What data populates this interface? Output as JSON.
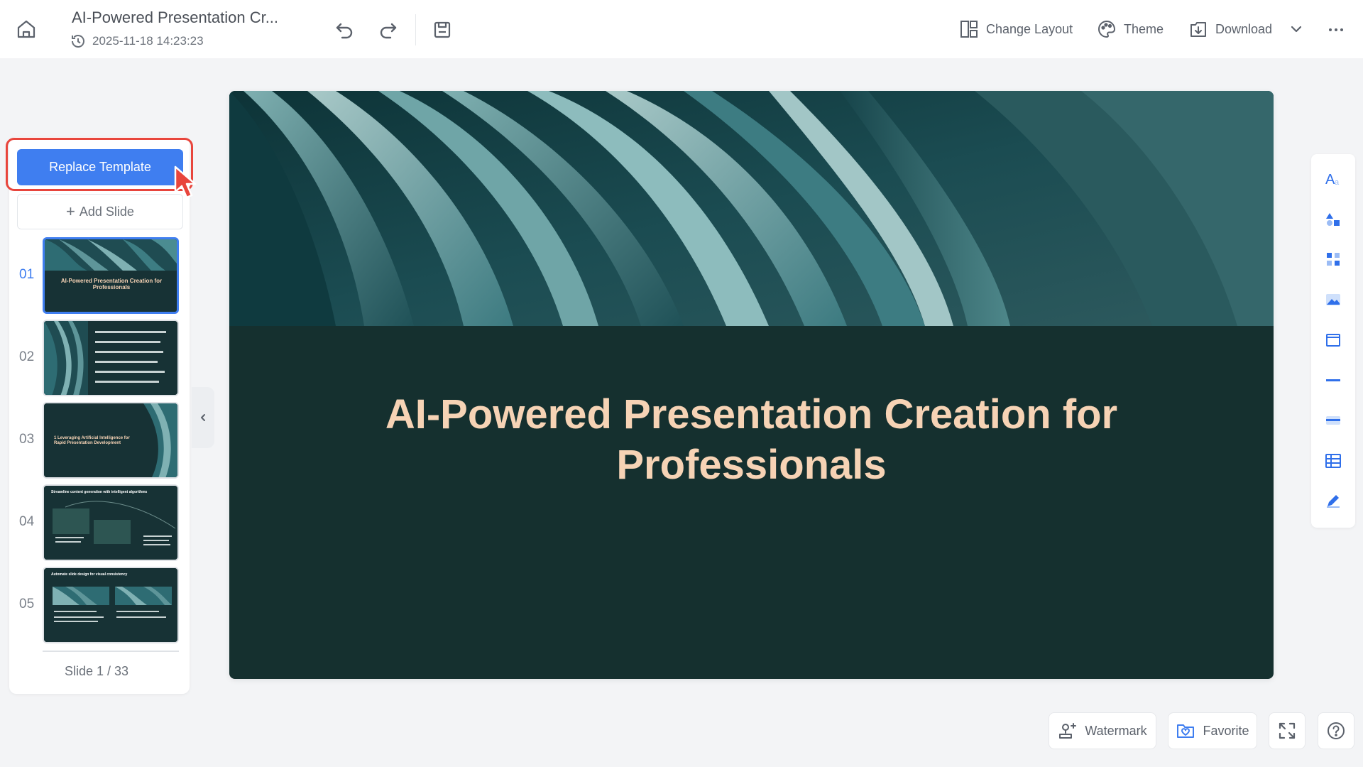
{
  "header": {
    "doc_title": "AI-Powered Presentation Cr...",
    "timestamp": "2025-11-18 14:23:23",
    "icons": [
      "home-icon",
      "history-icon",
      "undo-icon",
      "redo-icon",
      "save-icon"
    ],
    "actions": {
      "change_layout": "Change Layout",
      "theme": "Theme",
      "download": "Download"
    }
  },
  "sidebar": {
    "replace_template": "Replace Template",
    "add_slide": "Add Slide",
    "add_slide_glyph": "+",
    "slides": [
      {
        "num": "01",
        "text": "AI-Powered Presentation Creation for Professionals",
        "active": true
      },
      {
        "num": "02",
        "text": "",
        "active": false
      },
      {
        "num": "03",
        "text": "1 Leveraging Artificial Intelligence for Rapid Presentation Development",
        "active": false
      },
      {
        "num": "04",
        "text": "Streamline content generation with intelligent algorithms",
        "active": false
      },
      {
        "num": "05",
        "text": "Automate slide design for visual consistency",
        "active": false
      }
    ],
    "counter": "Slide 1 / 33"
  },
  "slide": {
    "title": "AI-Powered Presentation Creation for Professionals",
    "colors": {
      "background": "#15302f",
      "title": "#f6d3b5"
    }
  },
  "right_toolbar": {
    "icons": [
      "text-style-icon",
      "shapes-icon",
      "elements-icon",
      "image-icon",
      "frame-icon",
      "line-icon",
      "table-row-icon",
      "table-icon",
      "draw-icon"
    ]
  },
  "bottom": {
    "watermark": "Watermark",
    "favorite": "Favorite"
  },
  "colors": {
    "accent": "#3f7ef0",
    "highlight": "#e8453c"
  }
}
